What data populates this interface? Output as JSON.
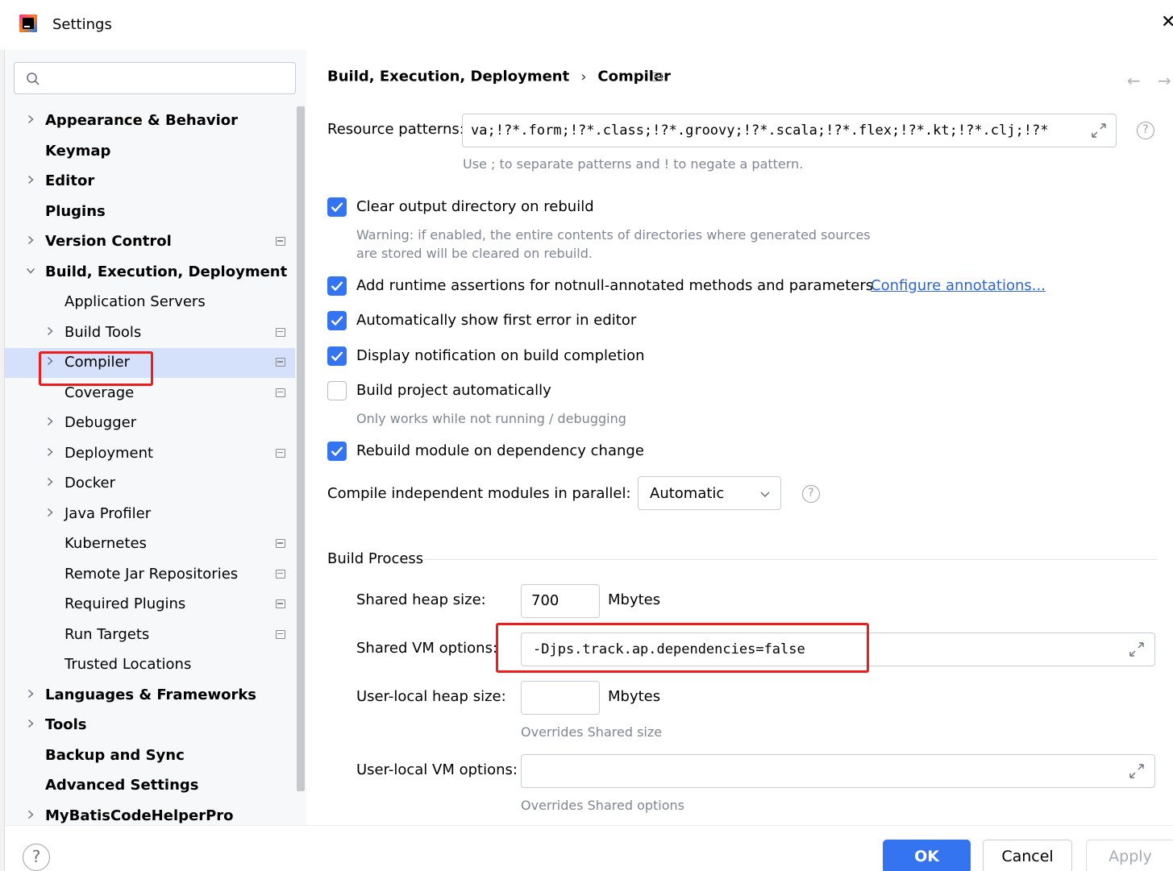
{
  "window": {
    "title": "Settings"
  },
  "search": {
    "placeholder": ""
  },
  "sidebar": {
    "items": [
      {
        "label": "Appearance & Behavior",
        "level": 0,
        "expandable": true,
        "expanded": false,
        "bold": true,
        "project": false
      },
      {
        "label": "Keymap",
        "level": 0,
        "expandable": false,
        "bold": true,
        "project": false
      },
      {
        "label": "Editor",
        "level": 0,
        "expandable": true,
        "expanded": false,
        "bold": true,
        "project": false
      },
      {
        "label": "Plugins",
        "level": 0,
        "expandable": false,
        "bold": true,
        "project": false
      },
      {
        "label": "Version Control",
        "level": 0,
        "expandable": true,
        "expanded": false,
        "bold": true,
        "project": true
      },
      {
        "label": "Build, Execution, Deployment",
        "level": 0,
        "expandable": true,
        "expanded": true,
        "bold": true,
        "project": false
      },
      {
        "label": "Application Servers",
        "level": 1,
        "expandable": false,
        "bold": false,
        "project": false
      },
      {
        "label": "Build Tools",
        "level": 1,
        "expandable": true,
        "expanded": false,
        "bold": false,
        "project": true
      },
      {
        "label": "Compiler",
        "level": 1,
        "expandable": true,
        "expanded": false,
        "bold": false,
        "project": true,
        "selected": true
      },
      {
        "label": "Coverage",
        "level": 1,
        "expandable": false,
        "bold": false,
        "project": true
      },
      {
        "label": "Debugger",
        "level": 1,
        "expandable": true,
        "expanded": false,
        "bold": false,
        "project": false
      },
      {
        "label": "Deployment",
        "level": 1,
        "expandable": true,
        "expanded": false,
        "bold": false,
        "project": true
      },
      {
        "label": "Docker",
        "level": 1,
        "expandable": true,
        "expanded": false,
        "bold": false,
        "project": false
      },
      {
        "label": "Java Profiler",
        "level": 1,
        "expandable": true,
        "expanded": false,
        "bold": false,
        "project": false
      },
      {
        "label": "Kubernetes",
        "level": 1,
        "expandable": false,
        "bold": false,
        "project": true
      },
      {
        "label": "Remote Jar Repositories",
        "level": 1,
        "expandable": false,
        "bold": false,
        "project": true
      },
      {
        "label": "Required Plugins",
        "level": 1,
        "expandable": false,
        "bold": false,
        "project": true
      },
      {
        "label": "Run Targets",
        "level": 1,
        "expandable": false,
        "bold": false,
        "project": true
      },
      {
        "label": "Trusted Locations",
        "level": 1,
        "expandable": false,
        "bold": false,
        "project": false
      },
      {
        "label": "Languages & Frameworks",
        "level": 0,
        "expandable": true,
        "expanded": false,
        "bold": true,
        "project": false
      },
      {
        "label": "Tools",
        "level": 0,
        "expandable": true,
        "expanded": false,
        "bold": true,
        "project": false
      },
      {
        "label": "Backup and Sync",
        "level": 0,
        "expandable": false,
        "bold": true,
        "project": false
      },
      {
        "label": "Advanced Settings",
        "level": 0,
        "expandable": false,
        "bold": true,
        "project": false
      },
      {
        "label": "MyBatisCodeHelperPro",
        "level": 0,
        "expandable": true,
        "expanded": false,
        "bold": true,
        "project": false
      }
    ]
  },
  "breadcrumb": {
    "parent": "Build, Execution, Deployment",
    "separator": "›",
    "current": "Compiler"
  },
  "nav": {
    "back": "←",
    "forward": "→"
  },
  "compiler": {
    "resource_patterns": {
      "label": "Resource patterns:",
      "value": "va;!?*.form;!?*.class;!?*.groovy;!?*.scala;!?*.flex;!?*.kt;!?*.clj;!?*",
      "hint": "Use ; to separate patterns and ! to negate a pattern."
    },
    "clear_output": {
      "label": "Clear output directory on rebuild",
      "checked": true,
      "warning_line1": "Warning: if enabled, the entire contents of directories where generated sources",
      "warning_line2": "are stored will be cleared on rebuild."
    },
    "runtime_assertions": {
      "label": "Add runtime assertions for notnull-annotated methods and parameters",
      "checked": true,
      "link": "Configure annotations..."
    },
    "show_first_error": {
      "label": "Automatically show first error in editor",
      "checked": true
    },
    "notify_build": {
      "label": "Display notification on build completion",
      "checked": true
    },
    "build_auto": {
      "label": "Build project automatically",
      "checked": false,
      "hint": "Only works while not running / debugging"
    },
    "rebuild_module": {
      "label": "Rebuild module on dependency change",
      "checked": true
    },
    "parallel": {
      "label": "Compile independent modules in parallel:",
      "value": "Automatic"
    }
  },
  "build_process": {
    "title": "Build Process",
    "shared_heap": {
      "label": "Shared heap size:",
      "value": "700",
      "unit": "Mbytes"
    },
    "shared_vm": {
      "label": "Shared VM options:",
      "value": "-Djps.track.ap.dependencies=false"
    },
    "user_heap": {
      "label": "User-local heap size:",
      "value": "",
      "unit": "Mbytes",
      "hint": "Overrides Shared size"
    },
    "user_vm": {
      "label": "User-local VM options:",
      "value": "",
      "hint": "Overrides Shared options"
    }
  },
  "footer": {
    "help": "?",
    "ok": "OK",
    "cancel": "Cancel",
    "apply": "Apply"
  },
  "colors": {
    "accent": "#3574f0",
    "selection": "#d5e1fb",
    "annotation_red": "#ef1c1c",
    "link": "#2d64d3"
  }
}
